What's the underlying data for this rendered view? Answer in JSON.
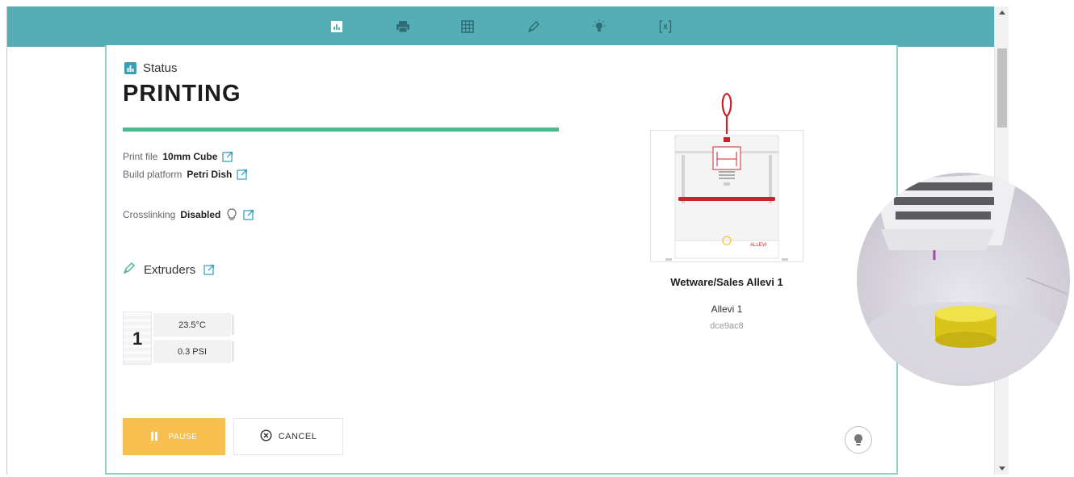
{
  "toolbar": {
    "items": [
      {
        "icon": "status-chart-icon"
      },
      {
        "icon": "printer-icon"
      },
      {
        "icon": "grid-icon"
      },
      {
        "icon": "pen-icon"
      },
      {
        "icon": "light-bulb-icon"
      },
      {
        "icon": "code-bracket-icon"
      }
    ]
  },
  "status": {
    "heading": "Status",
    "state": "PRINTING",
    "progress_percent": 100
  },
  "details": {
    "print_file_label": "Print file",
    "print_file_value": "10mm Cube",
    "build_platform_label": "Build platform",
    "build_platform_value": "Petri Dish",
    "crosslinking_label": "Crosslinking",
    "crosslinking_value": "Disabled"
  },
  "extruders": {
    "heading": "Extruders",
    "items": [
      {
        "number": "1",
        "temperature": "23.5°C",
        "pressure": "0.3 PSI"
      }
    ]
  },
  "actions": {
    "pause_label": "PAUSE",
    "cancel_label": "CANCEL"
  },
  "printer": {
    "name": "Wetware/Sales Allevi 1",
    "model": "Allevi 1",
    "id": "dce9ac8",
    "logo_text": "ALLEVI"
  },
  "colors": {
    "toolbar": "#55aeb5",
    "accent": "#3a9fb4",
    "progress": "#4fb88d",
    "pause": "#f6bf4f",
    "card_border": "#8fd2c0",
    "printer_red": "#c8232c"
  }
}
